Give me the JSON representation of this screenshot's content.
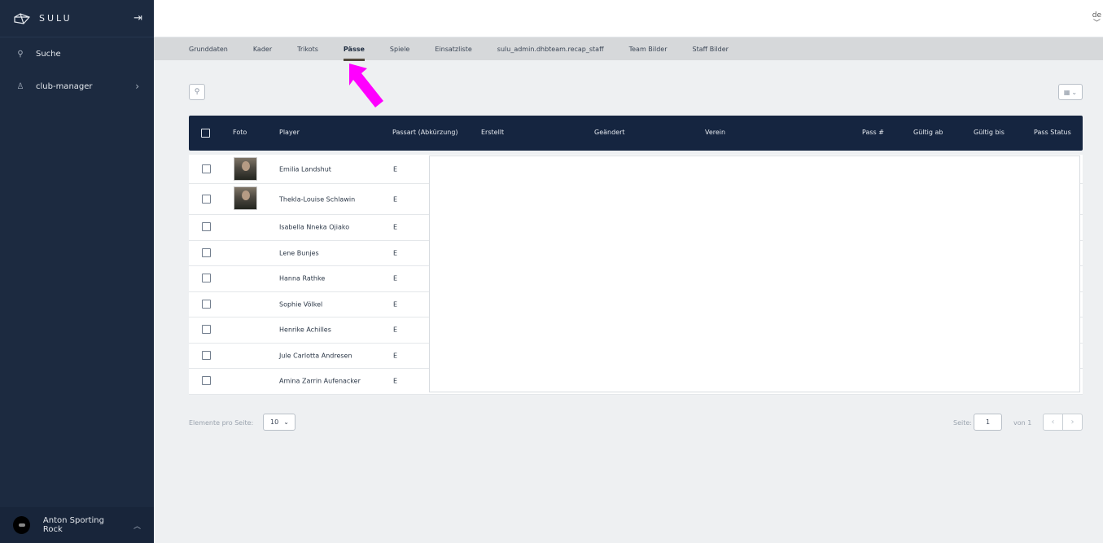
{
  "sidebar": {
    "logo_text": "SULU",
    "items": [
      {
        "icon": "search-icon",
        "label": "Suche"
      },
      {
        "icon": "person-icon",
        "label": "club-manager"
      }
    ],
    "user_name": "Anton Sporting Rock"
  },
  "topbar": {
    "lang": "de"
  },
  "tabs": [
    {
      "label": "Grunddaten"
    },
    {
      "label": "Kader"
    },
    {
      "label": "Trikots"
    },
    {
      "label": "Pässe",
      "active": true
    },
    {
      "label": "Spiele"
    },
    {
      "label": "Einsatzliste"
    },
    {
      "label": "sulu_admin.dhbteam.recap_staff"
    },
    {
      "label": "Team Bilder"
    },
    {
      "label": "Staff Bilder"
    }
  ],
  "table": {
    "columns": {
      "foto": "Foto",
      "player": "Player",
      "passart": "Passart (Abkürzung)",
      "erstellt": "Erstellt",
      "geaendert": "Geändert",
      "verein": "Verein",
      "pass_nr": "Pass #",
      "gueltig_ab": "Gültig ab",
      "gueltig_bis": "Gültig bis",
      "pass_status": "Pass Status"
    },
    "rows": [
      {
        "player": "Emilia Landshut",
        "passart": "E",
        "has_photo": true
      },
      {
        "player": "Thekla-Louise Schlawin",
        "passart": "E",
        "has_photo": true
      },
      {
        "player": "Isabella Nneka Ojiako",
        "passart": "E",
        "has_photo": false
      },
      {
        "player": "Lene Bunjes",
        "passart": "E",
        "has_photo": false
      },
      {
        "player": "Hanna Rathke",
        "passart": "E",
        "has_photo": false
      },
      {
        "player": "Sophie Völkel",
        "passart": "E",
        "has_photo": false
      },
      {
        "player": "Henrike Achilles",
        "passart": "E",
        "has_photo": false
      },
      {
        "player": "Jule Carlotta Andresen",
        "passart": "E",
        "has_photo": false
      },
      {
        "player": "Amina Zarrin Aufenacker",
        "passart": "E",
        "has_photo": false
      }
    ]
  },
  "pagination": {
    "per_page_label": "Elemente pro Seite:",
    "per_page_value": "10",
    "page_label": "Seite:",
    "page_value": "1",
    "of_label": "von 1"
  },
  "colors": {
    "sidebar_bg": "#1c2a40",
    "table_header_bg": "#152540",
    "arrow": "#ff00ff"
  }
}
